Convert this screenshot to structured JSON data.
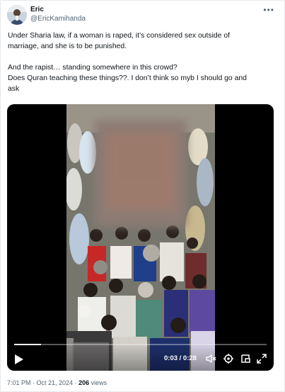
{
  "author": {
    "display_name": "Eric",
    "handle": "@EricKamihanda"
  },
  "more_icon": "more-horizontal-icon",
  "tweet": {
    "lines": [
      "Under Sharia law, if a woman is raped, it’s considered sex outside of",
      "marriage, and she is to be punished.",
      "",
      "And the rapist… standing somewhere in this crowd?",
      "Does Quran teaching these things??. I don’t think so myb I should go and",
      "ask"
    ]
  },
  "video": {
    "elapsed": "0:03",
    "duration": "0:28",
    "time_display": "0:03 / 0:28",
    "progress_fraction": 0.107,
    "icons": [
      "play-icon",
      "mute-icon",
      "settings-icon",
      "picture-in-picture-icon",
      "fullscreen-icon"
    ]
  },
  "meta": {
    "timestamp": "7:01 PM · Oct 21, 2024 · ",
    "views_count": "206",
    "views_label": " views"
  }
}
